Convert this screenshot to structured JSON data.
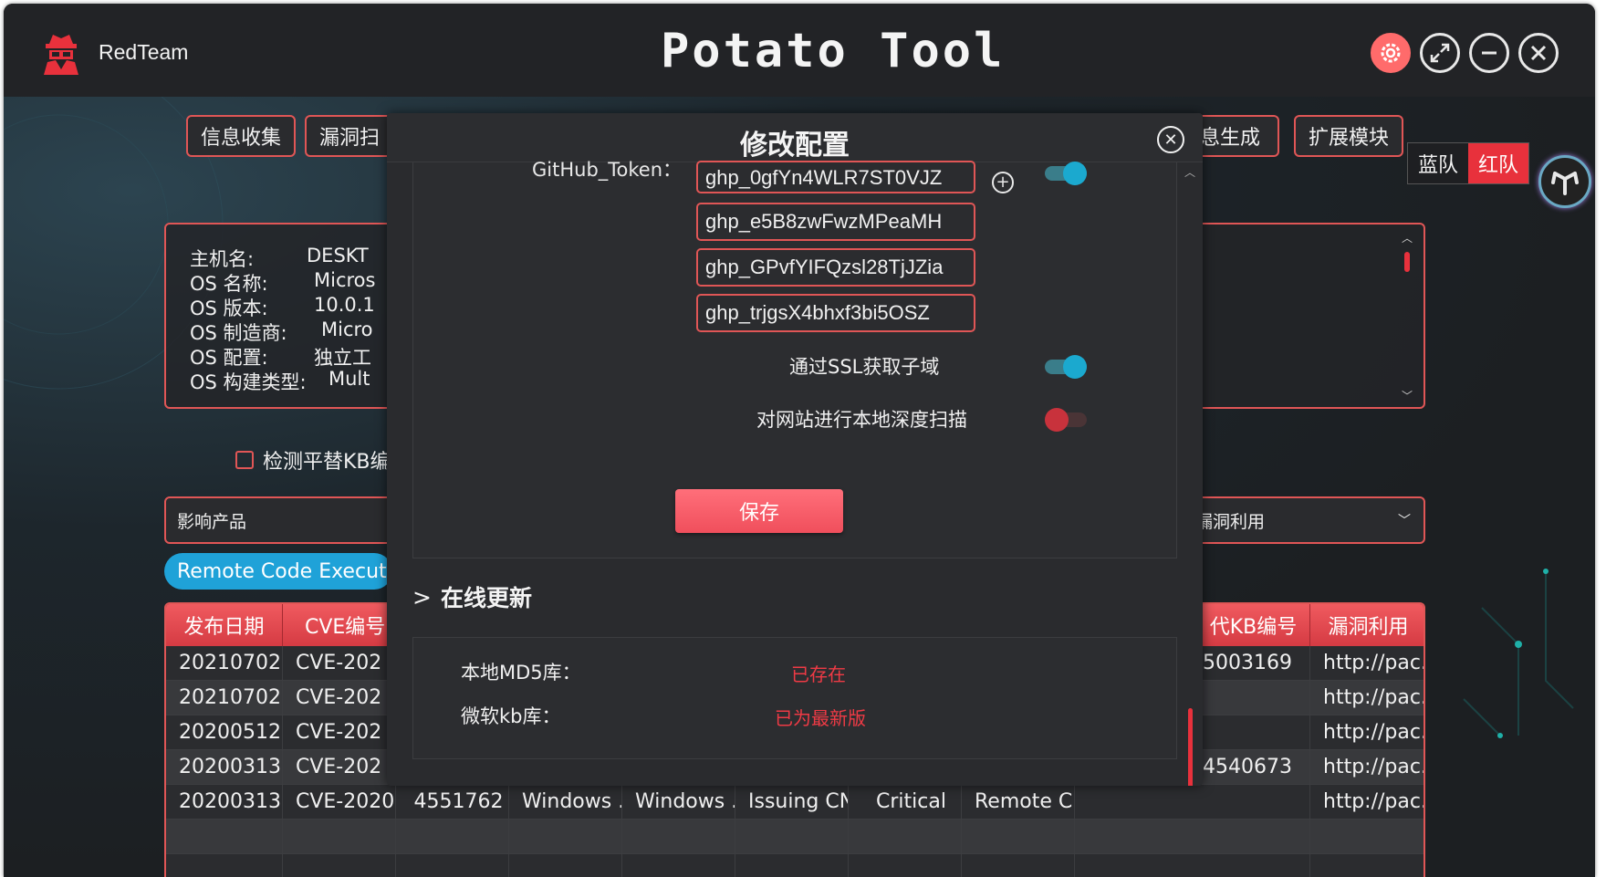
{
  "app": {
    "brand": "RedTeam",
    "title": "Potato Tool"
  },
  "nav": {
    "items": [
      "信息收集",
      "漏洞扫",
      "息生成",
      "扩展模块"
    ]
  },
  "team": {
    "blue": "蓝队",
    "red": "红队",
    "active": "red"
  },
  "sysinfo": {
    "rows": [
      {
        "label": "主机名:",
        "value": "DESKT"
      },
      {
        "label": "OS 名称:",
        "value": "Micros"
      },
      {
        "label": "OS 版本:",
        "value": "10.0.1"
      },
      {
        "label": "OS 制造商:",
        "value": "Micro"
      },
      {
        "label": "OS 配置:",
        "value": "独立工"
      },
      {
        "label": "OS 构建类型:",
        "value": "Mult"
      }
    ]
  },
  "kb_check": {
    "label": "检测平替KB编",
    "checked": false
  },
  "filters": {
    "product_placeholder": "影响产品",
    "exploit_placeholder": "漏洞利用",
    "tag": "Remote Code Executi"
  },
  "table": {
    "headers": [
      "发布日期",
      "CVE编号",
      "",
      "",
      "",
      "",
      "",
      "",
      "代KB编号",
      "漏洞利用"
    ],
    "rows": [
      [
        "20210702",
        "CVE-202",
        "",
        "",
        "",
        "",
        "",
        "",
        "5003169",
        "http://pac..."
      ],
      [
        "20210702",
        "CVE-202",
        "",
        "",
        "",
        "",
        "",
        "",
        "",
        "http://pac..."
      ],
      [
        "20200512",
        "CVE-202",
        "",
        "",
        "",
        "",
        "",
        "",
        "",
        "http://pac..."
      ],
      [
        "20200313",
        "CVE-202",
        "",
        "",
        "",
        "",
        "",
        "",
        "4540673",
        "http://pac..."
      ],
      [
        "20200313",
        "CVE-2020...",
        "4551762",
        "Windows ...",
        "Windows ...",
        "Issuing CNA",
        "Critical",
        "Remote C...",
        "",
        "http://pac..."
      ],
      [
        "",
        "",
        "",
        "",
        "",
        "",
        "",
        "",
        "",
        ""
      ],
      [
        "",
        "",
        "",
        "",
        "",
        "",
        "",
        "",
        "",
        ""
      ]
    ]
  },
  "modal": {
    "title": "修改配置",
    "github_label": "GitHub_Token：",
    "tokens": [
      "ghp_0gfYn4WLR7ST0VJZ",
      "ghp_e5B8zwFwzMPeaMH",
      "ghp_GPvfYIFQzsl28TjJZia",
      "ghp_trjgsX4bhxf3bi5OSZ"
    ],
    "github_enabled": true,
    "options": [
      {
        "label": "通过SSL获取子域",
        "enabled": true
      },
      {
        "label": "对网站进行本地深度扫描",
        "enabled": false
      }
    ],
    "save_label": "保存",
    "update_title": "在线更新",
    "update_rows": [
      {
        "label": "本地MD5库：",
        "status": "已存在"
      },
      {
        "label": "微软kb库：",
        "status": "已为最新版"
      }
    ]
  },
  "colors": {
    "accent": "#e8313c",
    "border": "#e05656",
    "toggle_on": "#1ba9cf",
    "tag": "#1fa2d8"
  }
}
